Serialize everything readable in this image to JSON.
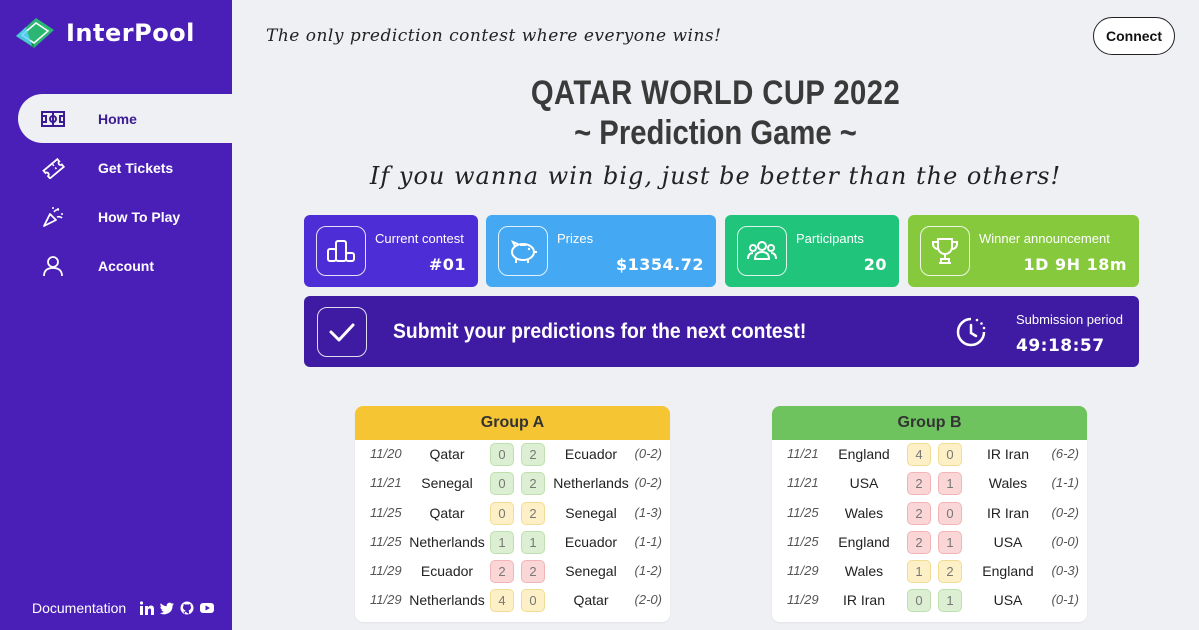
{
  "app": {
    "name": "InterPool",
    "tagline": "The only prediction contest where everyone wins!"
  },
  "header": {
    "connect_label": "Connect"
  },
  "sidebar": {
    "items": [
      {
        "label": "Home",
        "icon": "field-icon",
        "active": true
      },
      {
        "label": "Get Tickets",
        "icon": "ticket-icon"
      },
      {
        "label": "How To Play",
        "icon": "party-popper-icon"
      },
      {
        "label": "Account",
        "icon": "user-icon"
      }
    ],
    "footer": {
      "documentation_label": "Documentation",
      "socials": [
        "linkedin-icon",
        "twitter-icon",
        "github-icon",
        "youtube-icon"
      ]
    }
  },
  "main": {
    "title_line1": "QATAR WORLD CUP 2022",
    "title_line2": "~ Prediction Game ~",
    "subtitle": "If you wanna win big, just be better than the others!",
    "cards": [
      {
        "label": "Current contest",
        "value": "#01",
        "icon": "podium-icon",
        "color": "#4d2ed6"
      },
      {
        "label": "Prizes",
        "value": "$1354.72",
        "icon": "piggy-bank-icon",
        "color": "#45a8f2"
      },
      {
        "label": "Participants",
        "value": "20",
        "icon": "people-icon",
        "color": "#20c47a"
      },
      {
        "label": "Winner announcement",
        "value": "1D 9H 18m",
        "icon": "trophy-icon",
        "color": "#86c93c"
      }
    ],
    "banner": {
      "message": "Submit your predictions for the next contest!",
      "period_label": "Submission period",
      "period_value": "49:18:57",
      "icon": "checkmark-icon",
      "timer_icon": "timer-icon"
    },
    "groups": [
      {
        "name": "Group A",
        "header_color": "#f5c534",
        "matches": [
          {
            "date": "11/20",
            "team1": "Qatar",
            "score1": "0",
            "score2": "2",
            "team2": "Ecuador",
            "result": "(0-2)",
            "c1": "gr",
            "c2": "gr"
          },
          {
            "date": "11/21",
            "team1": "Senegal",
            "score1": "0",
            "score2": "2",
            "team2": "Netherlands",
            "result": "(0-2)",
            "c1": "gr",
            "c2": "gr"
          },
          {
            "date": "11/25",
            "team1": "Qatar",
            "score1": "0",
            "score2": "2",
            "team2": "Senegal",
            "result": "(1-3)",
            "c1": "yl",
            "c2": "yl"
          },
          {
            "date": "11/25",
            "team1": "Netherlands",
            "score1": "1",
            "score2": "1",
            "team2": "Ecuador",
            "result": "(1-1)",
            "c1": "gr",
            "c2": "gr"
          },
          {
            "date": "11/29",
            "team1": "Ecuador",
            "score1": "2",
            "score2": "2",
            "team2": "Senegal",
            "result": "(1-2)",
            "c1": "rd",
            "c2": "rd"
          },
          {
            "date": "11/29",
            "team1": "Netherlands",
            "score1": "4",
            "score2": "0",
            "team2": "Qatar",
            "result": "(2-0)",
            "c1": "yl",
            "c2": "yl"
          }
        ]
      },
      {
        "name": "Group B",
        "header_color": "#6ec35e",
        "matches": [
          {
            "date": "11/21",
            "team1": "England",
            "score1": "4",
            "score2": "0",
            "team2": "IR Iran",
            "result": "(6-2)",
            "c1": "yl",
            "c2": "yl"
          },
          {
            "date": "11/21",
            "team1": "USA",
            "score1": "2",
            "score2": "1",
            "team2": "Wales",
            "result": "(1-1)",
            "c1": "rd",
            "c2": "rd"
          },
          {
            "date": "11/25",
            "team1": "Wales",
            "score1": "2",
            "score2": "0",
            "team2": "IR Iran",
            "result": "(0-2)",
            "c1": "rd",
            "c2": "rd"
          },
          {
            "date": "11/25",
            "team1": "England",
            "score1": "2",
            "score2": "1",
            "team2": "USA",
            "result": "(0-0)",
            "c1": "rd",
            "c2": "rd"
          },
          {
            "date": "11/29",
            "team1": "Wales",
            "score1": "1",
            "score2": "2",
            "team2": "England",
            "result": "(0-3)",
            "c1": "yl",
            "c2": "yl"
          },
          {
            "date": "11/29",
            "team1": "IR Iran",
            "score1": "0",
            "score2": "1",
            "team2": "USA",
            "result": "(0-1)",
            "c1": "gr",
            "c2": "gr"
          }
        ]
      }
    ]
  }
}
